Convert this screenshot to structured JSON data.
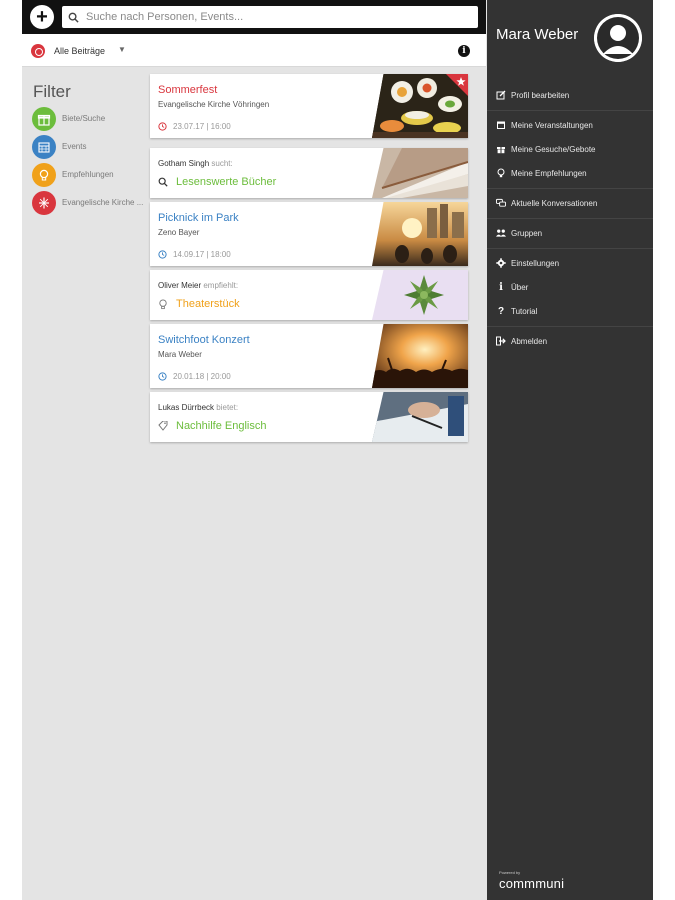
{
  "header": {
    "add_icon": "plus-icon",
    "search_placeholder": "Suche nach Personen, Events..."
  },
  "filterbar": {
    "label": "Alle Beiträge"
  },
  "filter_panel": {
    "title": "Filter",
    "items": [
      {
        "label": "Biete/Suche",
        "color": "#6cbd3c",
        "icon": "gift-icon"
      },
      {
        "label": "Events",
        "color": "#3b82c4",
        "icon": "calendar-icon"
      },
      {
        "label": "Empfehlungen",
        "color": "#f0a11a",
        "icon": "lightbulb-icon"
      },
      {
        "label": "Evangelische Kirche ...",
        "color": "#d9363e",
        "icon": "church-icon"
      }
    ]
  },
  "feed": [
    {
      "type": "event",
      "title": "Sommerfest",
      "subtitle": "Evangelische Kirche Vöhringen",
      "meta": "23.07.17 | 16:00",
      "color": "#d9363e"
    },
    {
      "type": "offer",
      "person": "Gotham Singh",
      "verb": "sucht:",
      "title": "Lesenswerte Bücher",
      "color": "#6cbd3c"
    },
    {
      "type": "event",
      "title": "Picknick im Park",
      "subtitle": "Zeno Bayer",
      "meta": "14.09.17 | 18:00",
      "color": "#3b82c4"
    },
    {
      "type": "offer",
      "person": "Oliver Meier",
      "verb": "empfiehlt:",
      "title": "Theaterstück",
      "color": "#f0a11a"
    },
    {
      "type": "event",
      "title": "Switchfoot Konzert",
      "subtitle": "Mara Weber",
      "meta": "20.01.18 | 20:00",
      "color": "#3b82c4"
    },
    {
      "type": "offer",
      "person": "Lukas Dürrbeck",
      "verb": "bietet:",
      "title": "Nachhilfe Englisch",
      "color": "#6cbd3c"
    }
  ],
  "drawer": {
    "user_name": "Mara Weber",
    "items": [
      {
        "label": "Profil bearbeiten",
        "icon": "edit-icon"
      },
      {
        "label": "Meine Veranstaltungen",
        "icon": "calendar-icon"
      },
      {
        "label": "Meine Gesuche/Gebote",
        "icon": "gift-icon"
      },
      {
        "label": "Meine Empfehlungen",
        "icon": "lightbulb-icon"
      },
      {
        "label": "Aktuelle Konversationen",
        "icon": "chat-icon"
      },
      {
        "label": "Gruppen",
        "icon": "group-icon"
      },
      {
        "label": "Einstellungen",
        "icon": "gear-icon"
      },
      {
        "label": "Über",
        "icon": "info-icon"
      },
      {
        "label": "Tutorial",
        "icon": "question-icon"
      },
      {
        "label": "Abmelden",
        "icon": "logout-icon"
      }
    ],
    "powered_by": "Powered by",
    "brand": "commmuni"
  }
}
